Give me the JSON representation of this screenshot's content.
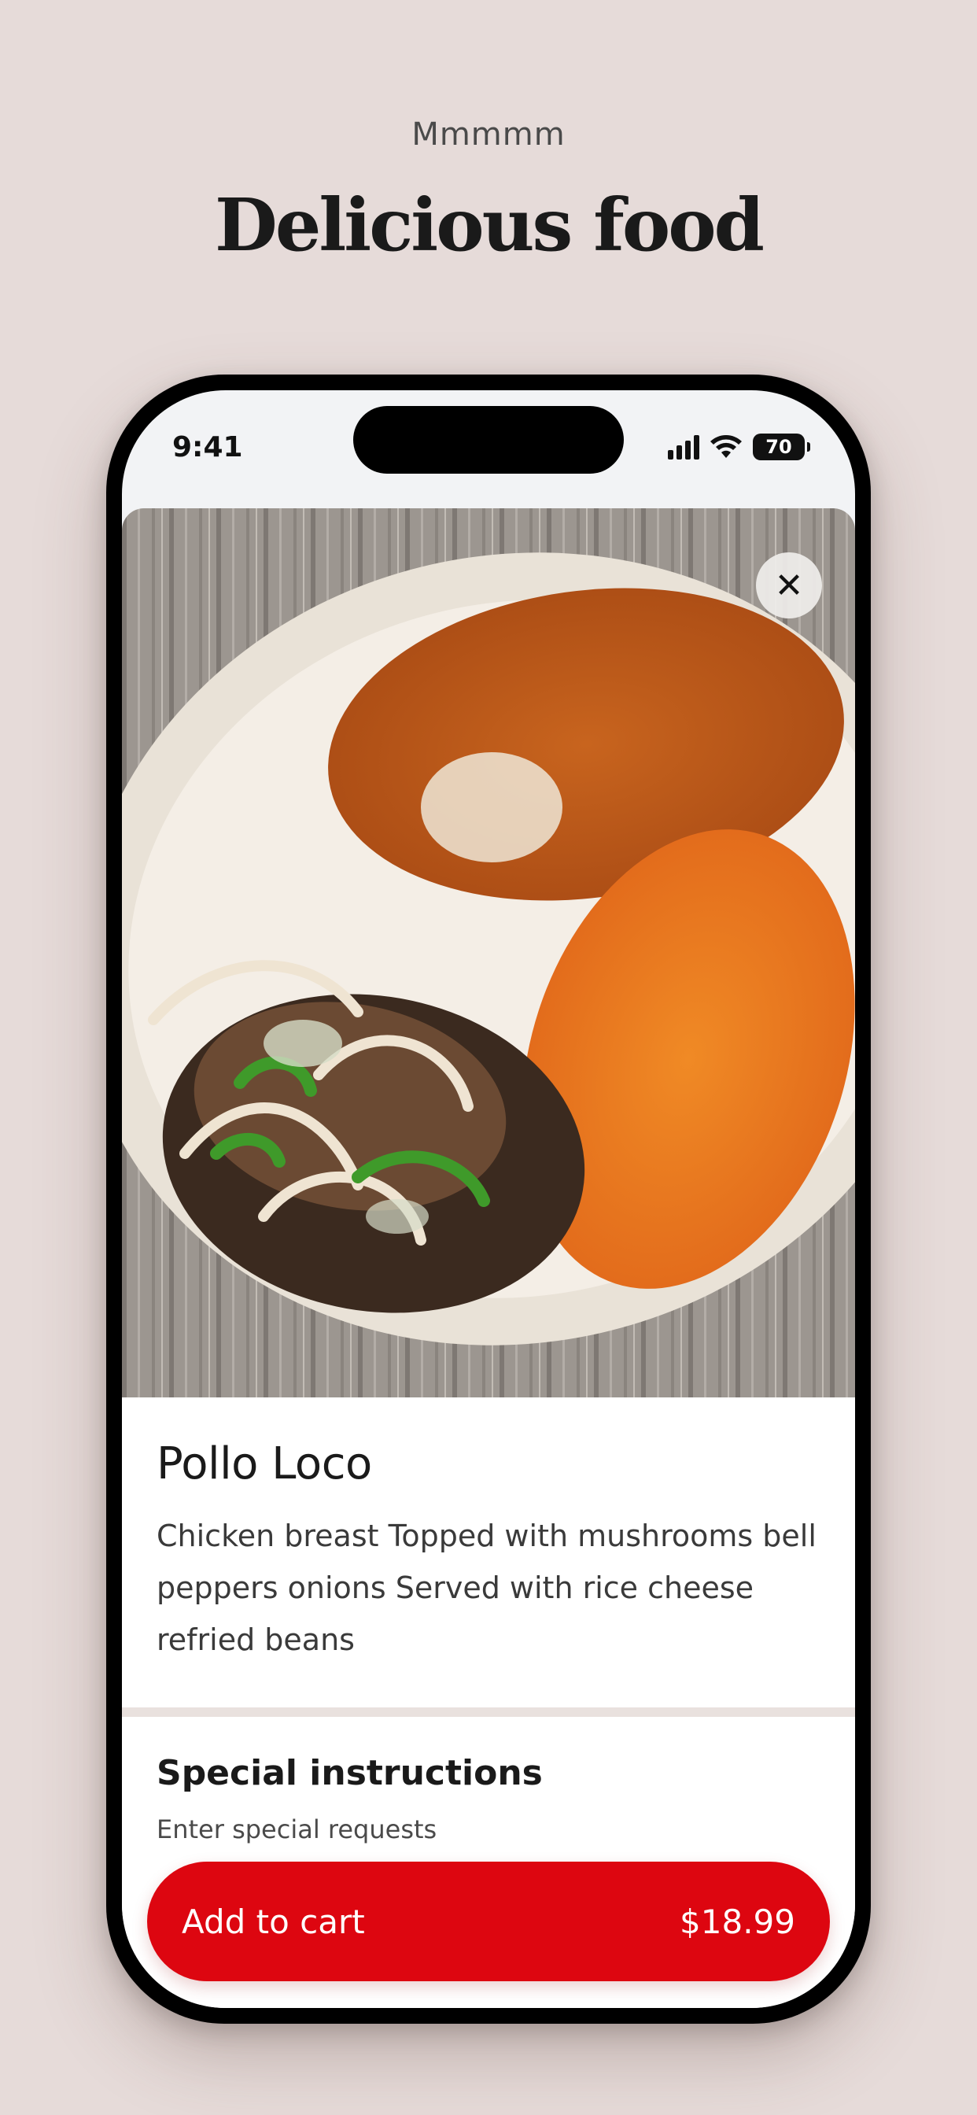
{
  "header": {
    "eyebrow": "Mmmmm",
    "title": "Delicious food"
  },
  "status_bar": {
    "time": "9:41",
    "battery": "70"
  },
  "item": {
    "image_alt": "Plate with grilled chicken, peppers, onions, rice and refried beans",
    "close_icon": "close-icon",
    "name": "Pollo Loco",
    "description": "Chicken breast Topped with mushrooms bell peppers onions Served with rice cheese refried beans"
  },
  "special_instructions": {
    "title": "Special instructions",
    "placeholder": "Enter special requests"
  },
  "cart": {
    "label": "Add to cart",
    "price": "$18.99"
  },
  "colors": {
    "background": "#e6dbd9",
    "accent": "#dd0610"
  }
}
